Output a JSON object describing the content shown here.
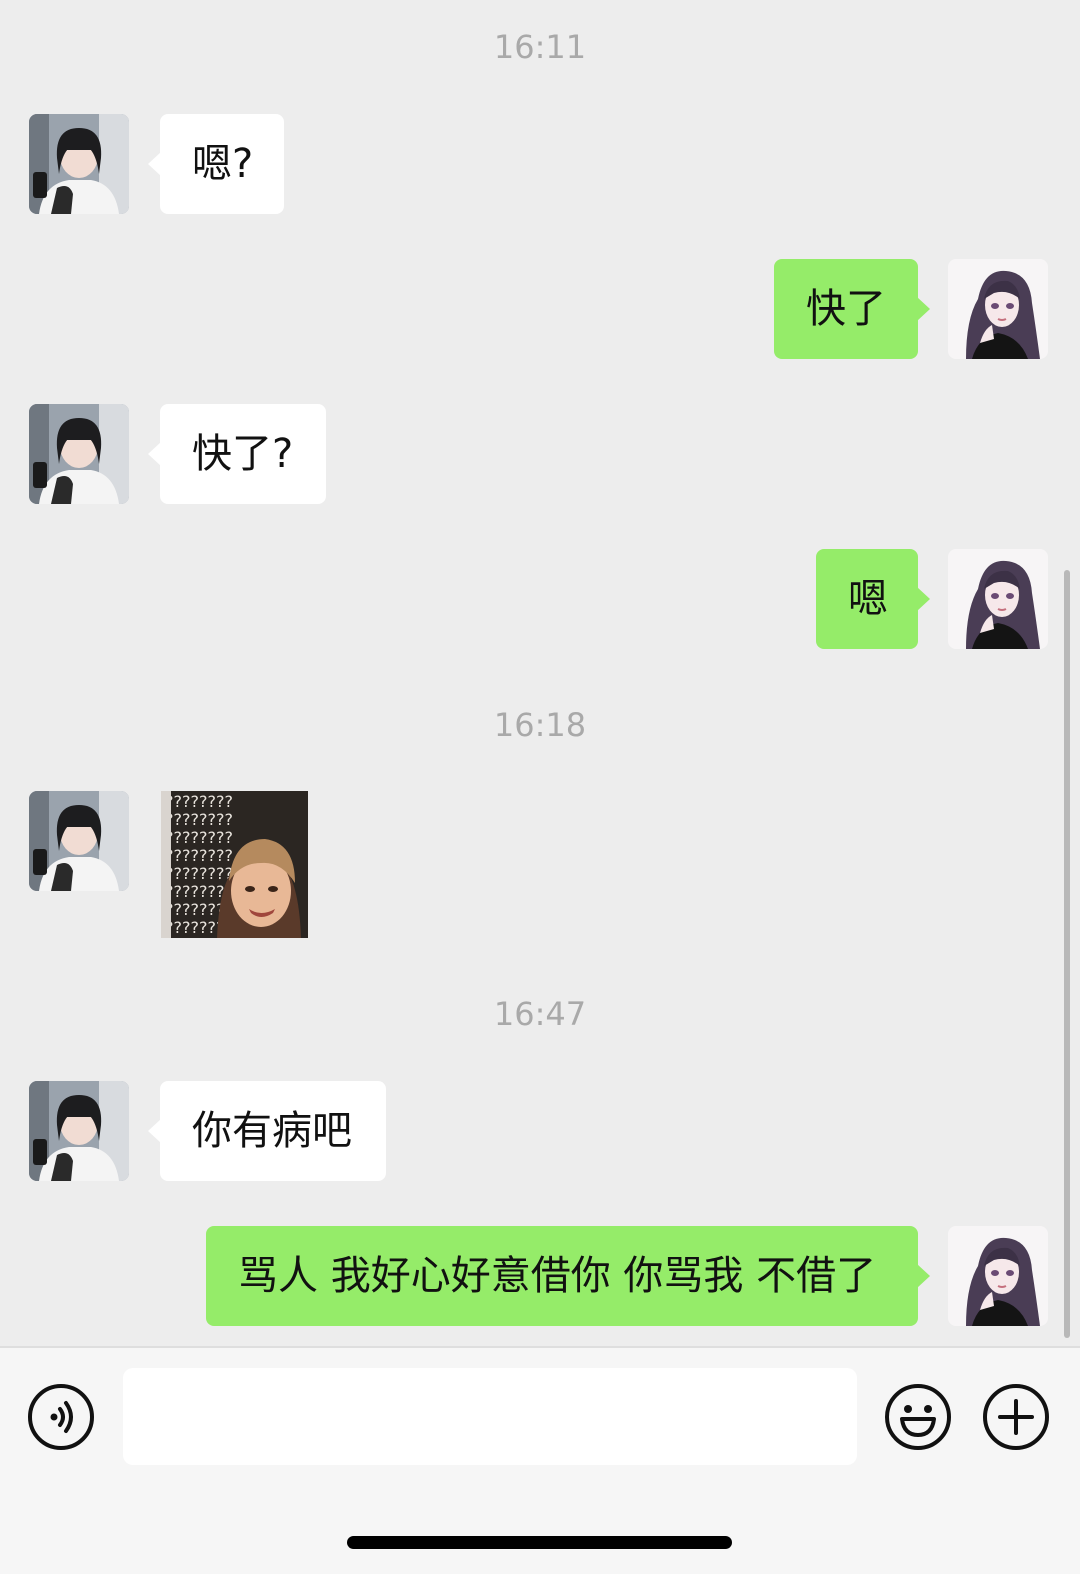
{
  "timestamps": [
    "16:11",
    "16:18",
    "16:47"
  ],
  "messages": [
    {
      "side": "in",
      "text": "嗯?"
    },
    {
      "side": "out",
      "text": "快了"
    },
    {
      "side": "in",
      "text": "快了?"
    },
    {
      "side": "out",
      "text": "嗯"
    },
    {
      "side": "in",
      "type": "sticker",
      "sticker_text": "????????"
    },
    {
      "side": "in",
      "text": "你有病吧"
    },
    {
      "side": "out",
      "text": "骂人 我好心好意借你 你骂我 不借了"
    }
  ],
  "input_bar": {
    "placeholder": "",
    "voice_icon": "voice-icon",
    "emoji_icon": "emoji-icon",
    "plus_icon": "plus-icon"
  },
  "colors": {
    "background": "#ededed",
    "incoming_bubble": "#ffffff",
    "outgoing_bubble": "#95ec69",
    "timestamp": "#a9a9a9"
  }
}
